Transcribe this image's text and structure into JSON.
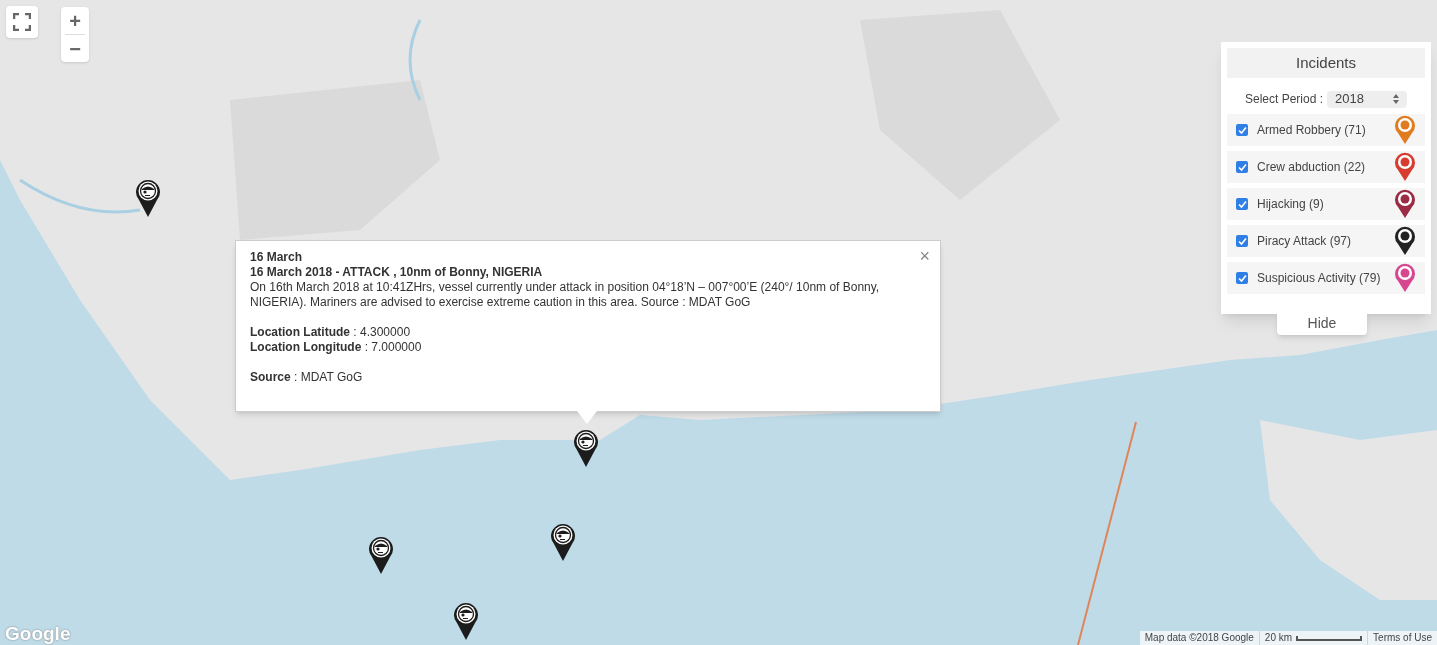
{
  "map_controls": {
    "zoom_in": "+",
    "zoom_out": "−"
  },
  "popup": {
    "title": "16 March",
    "heading": "16 March 2018 - ATTACK , 10nm of Bonny, NIGERIA",
    "body": "On 16th March 2018 at 10:41ZHrs, vessel currently under attack in position 04°18’N – 007°00’E (240°/ 10nm of Bonny, NIGERIA). Mariners are advised to exercise extreme caution in this area. Source : MDAT GoG",
    "fields": [
      "**Location Latitude** : 4.300000",
      "**Location Longitude** : 7.000000"
    ],
    "source": "**Source** : MDAT GoG",
    "close": "×"
  },
  "incidents_panel": {
    "title": "Incidents",
    "period_label": "Select Period :",
    "period_value": "2018",
    "items": [
      {
        "label": "Armed Robbery (71)",
        "checked": true,
        "color": "#e07b1f"
      },
      {
        "label": "Crew abduction (22)",
        "checked": true,
        "color": "#d63c2f"
      },
      {
        "label": "Hijacking (9)",
        "checked": true,
        "color": "#9b2a45"
      },
      {
        "label": "Piracy Attack (97)",
        "checked": true,
        "color": "#222222"
      },
      {
        "label": "Suspicious Activity (79)",
        "checked": true,
        "color": "#d6478f"
      }
    ],
    "hide_button": "Hide"
  },
  "google_logo": "Google",
  "attribution": {
    "map_data": "Map data ©2018 Google",
    "scale": "20 km",
    "terms": "Terms of Use"
  }
}
